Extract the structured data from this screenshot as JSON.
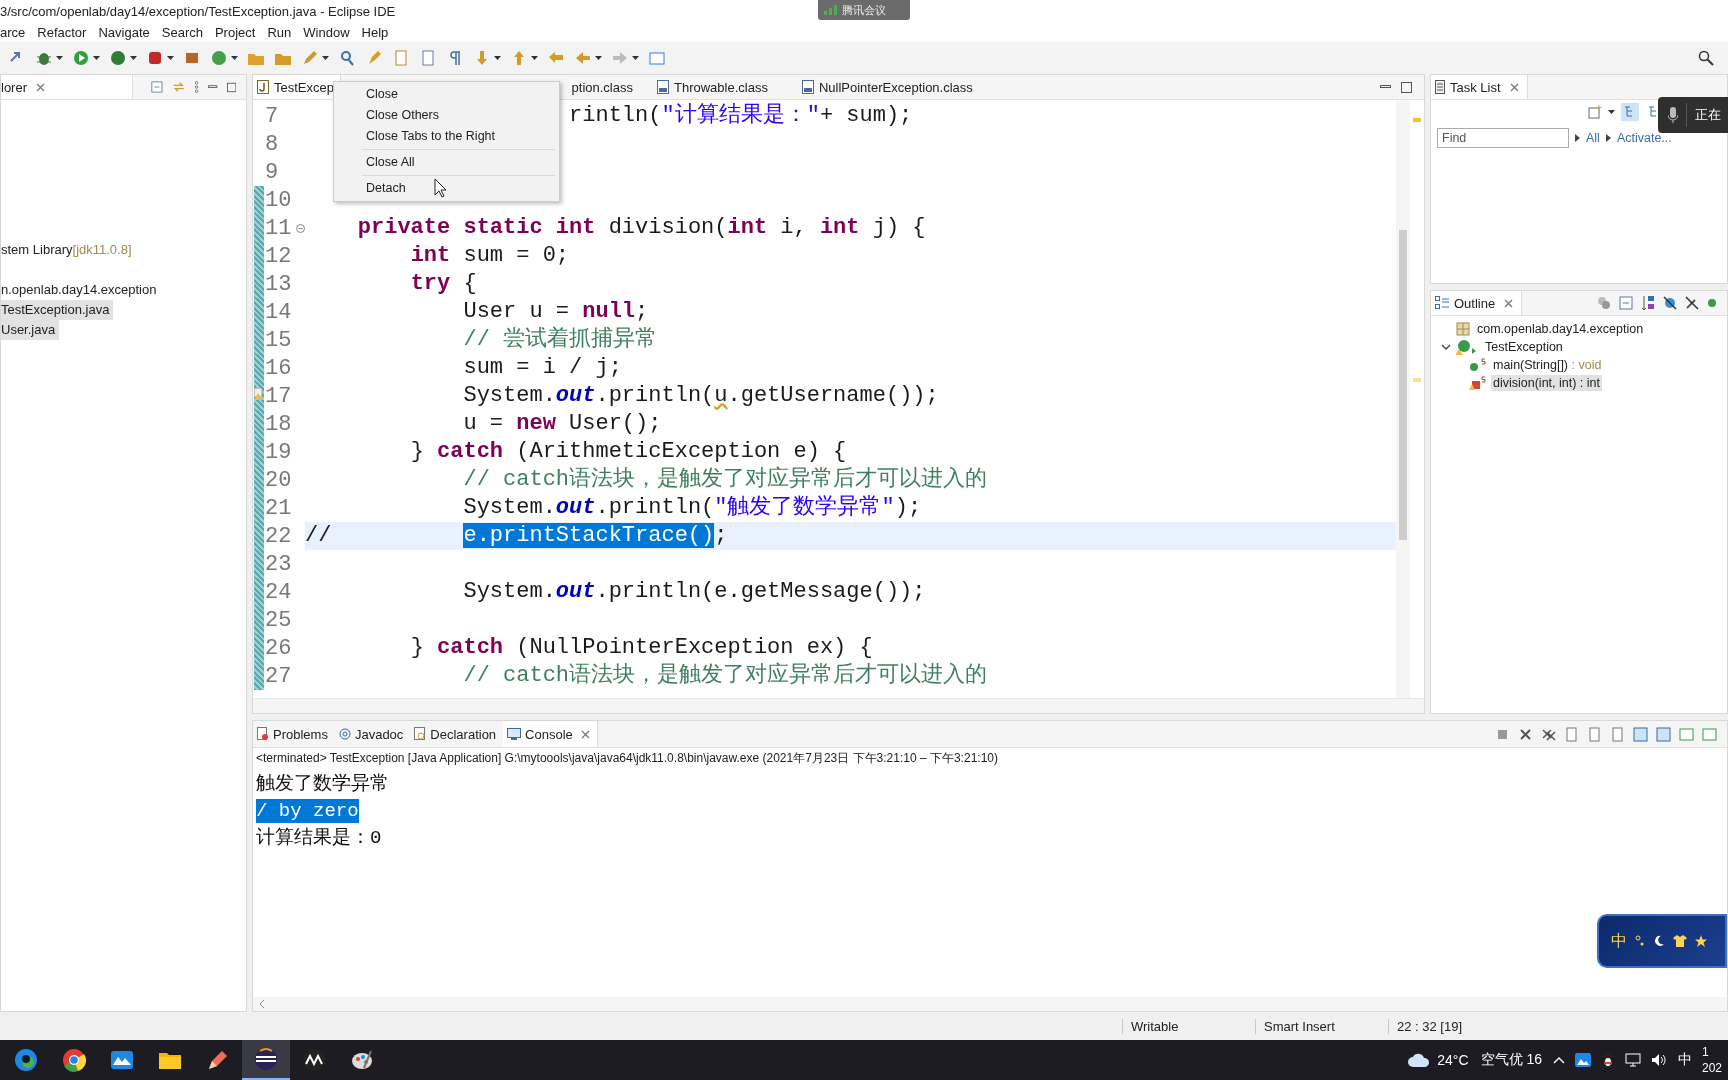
{
  "window": {
    "title": "3/src/com/openlab/day14/exception/TestException.java - Eclipse IDE"
  },
  "meeting_badge": {
    "label": "腾讯会议"
  },
  "menu": [
    "arce",
    "Refactor",
    "Navigate",
    "Search",
    "Project",
    "Run",
    "Window",
    "Help"
  ],
  "explorer": {
    "tab": "lorer",
    "items": [
      {
        "label": "stem Library",
        "detail": "[jdk11.0.8]",
        "selected": false
      },
      {
        "label": "n.openlab.day14.exception",
        "selected": false,
        "children": [
          {
            "label": "TestException.java",
            "selected": true
          },
          {
            "label": "User.java",
            "selected": true
          }
        ]
      }
    ]
  },
  "editor": {
    "tabs": [
      {
        "label": "TestExcep",
        "kind": "java",
        "selected": true
      },
      {
        "label": "ption.class",
        "selected": false
      },
      {
        "label": "Throwable.class",
        "kind": "class",
        "selected": false
      },
      {
        "label": "NullPointerException.class",
        "kind": "class",
        "selected": false
      }
    ],
    "lines": [
      {
        "number": "7",
        "changed": false,
        "current": false,
        "tokens": [
          {
            "text": "                    rintln(",
            "kind": "p"
          },
          {
            "text": "\"计算结果是：\"",
            "kind": "s"
          },
          {
            "text": "+ sum);",
            "kind": "p"
          }
        ]
      },
      {
        "number": "8",
        "changed": false,
        "current": false
      },
      {
        "number": "9",
        "changed": false,
        "current": false
      },
      {
        "number": "10",
        "changed": true,
        "current": false
      },
      {
        "number": "11",
        "changed": true,
        "current": false,
        "kind": "fold",
        "tokens": [
          {
            "text": "    private ",
            "kind": "k"
          },
          {
            "text": "static ",
            "kind": "k"
          },
          {
            "text": "int",
            "kind": "k"
          },
          {
            "text": " division(",
            "kind": "p"
          },
          {
            "text": "int",
            "kind": "k"
          },
          {
            "text": " i, ",
            "kind": "p"
          },
          {
            "text": "int",
            "kind": "k"
          },
          {
            "text": " j) {",
            "kind": "p"
          }
        ]
      },
      {
        "number": "12",
        "changed": true,
        "current": false,
        "tokens": [
          {
            "text": "        int",
            "kind": "k"
          },
          {
            "text": " sum = 0;",
            "kind": "p"
          }
        ]
      },
      {
        "number": "13",
        "changed": true,
        "current": false,
        "tokens": [
          {
            "text": "        try",
            "kind": "k"
          },
          {
            "text": " {",
            "kind": "p"
          }
        ]
      },
      {
        "number": "14",
        "changed": true,
        "current": false,
        "tokens": [
          {
            "text": "            User u = ",
            "kind": "p"
          },
          {
            "text": "null",
            "kind": "k"
          },
          {
            "text": ";",
            "kind": "p"
          }
        ]
      },
      {
        "number": "15",
        "changed": true,
        "current": false,
        "tokens": [
          {
            "text": "            // 尝试着抓捕异常",
            "kind": "c"
          }
        ]
      },
      {
        "number": "16",
        "changed": true,
        "current": false,
        "tokens": [
          {
            "text": "            sum = i / j;",
            "kind": "p"
          }
        ]
      },
      {
        "number": "17",
        "changed": true,
        "current": false,
        "kind": "warning",
        "tokens": [
          {
            "text": "            System.",
            "kind": "p"
          },
          {
            "text": "out",
            "kind": "f"
          },
          {
            "text": ".println(",
            "kind": "p"
          },
          {
            "text": "u",
            "kind": "w"
          },
          {
            "text": ".getUsername());",
            "kind": "p"
          }
        ]
      },
      {
        "number": "18",
        "changed": true,
        "current": false,
        "tokens": [
          {
            "text": "            u = ",
            "kind": "p"
          },
          {
            "text": "new",
            "kind": "k"
          },
          {
            "text": " User();",
            "kind": "p"
          }
        ]
      },
      {
        "number": "19",
        "changed": true,
        "current": false,
        "tokens": [
          {
            "text": "        } ",
            "kind": "p"
          },
          {
            "text": "catch",
            "kind": "k"
          },
          {
            "text": " (ArithmeticException e) {",
            "kind": "p"
          }
        ]
      },
      {
        "number": "20",
        "changed": true,
        "current": false,
        "tokens": [
          {
            "text": "            // catch语法块，是触发了对应异常后才可以进入的",
            "kind": "c"
          }
        ]
      },
      {
        "number": "21",
        "changed": true,
        "current": false,
        "tokens": [
          {
            "text": "            System.",
            "kind": "p"
          },
          {
            "text": "out",
            "kind": "f"
          },
          {
            "text": ".println(",
            "kind": "p"
          },
          {
            "text": "\"触发了数学异常\"",
            "kind": "s"
          },
          {
            "text": ");",
            "kind": "p"
          }
        ]
      },
      {
        "number": "22",
        "changed": true,
        "current": true,
        "tokens": [
          {
            "text": "//          ",
            "kind": "p"
          },
          {
            "text": "e.printStackTrace()",
            "kind": "sel"
          },
          {
            "text": ";",
            "kind": "p"
          }
        ]
      },
      {
        "number": "23",
        "changed": true,
        "current": false
      },
      {
        "number": "24",
        "changed": true,
        "current": false,
        "tokens": [
          {
            "text": "            System.",
            "kind": "p"
          },
          {
            "text": "out",
            "kind": "f"
          },
          {
            "text": ".println(e.getMessage());",
            "kind": "p"
          }
        ]
      },
      {
        "number": "25",
        "changed": true,
        "current": false
      },
      {
        "number": "26",
        "changed": true,
        "current": false,
        "tokens": [
          {
            "text": "        } ",
            "kind": "p"
          },
          {
            "text": "catch",
            "kind": "k"
          },
          {
            "text": " (NullPointerException ex) {",
            "kind": "p"
          }
        ]
      },
      {
        "number": "27",
        "changed": true,
        "current": false,
        "tokens": [
          {
            "text": "            // catch语法块，是触发了对应异常后才可以进入的",
            "kind": "c"
          }
        ]
      }
    ]
  },
  "context_menu": {
    "groups": [
      [
        "Close",
        "Close Others",
        "Close Tabs to the Right"
      ],
      [
        "Close All"
      ],
      [
        "Detach"
      ]
    ]
  },
  "task_list": {
    "tab": "Task List",
    "find": {
      "placeholder": "Find"
    },
    "links": [
      "All",
      "Activate..."
    ]
  },
  "meeting_overlay": {
    "label": "正在"
  },
  "outline": {
    "tab": "Outline",
    "items": [
      {
        "label": "com.openlab.day14.exception",
        "kind": "package",
        "selected": false
      },
      {
        "label": "TestException",
        "kind": "class",
        "expanded": true,
        "selected": false,
        "children": [
          {
            "label": "main(String[])",
            "type": " : void",
            "kind": "public",
            "selected": false
          },
          {
            "label": "division(int, int) : int",
            "kind": "private",
            "selected": true
          }
        ]
      }
    ]
  },
  "console": {
    "tabs": [
      {
        "label": "Problems",
        "kind": "problems",
        "selected": false
      },
      {
        "label": "Javadoc",
        "kind": "at",
        "selected": false
      },
      {
        "label": "Declaration",
        "kind": "declaration",
        "selected": false
      },
      {
        "label": "Console",
        "kind": "console",
        "selected": true
      }
    ],
    "status": "<terminated> TestException [Java Application] G:\\mytoools\\java\\java64\\jdk11.0.8\\bin\\javaw.exe  (2021年7月23日 下午3:21:10 – 下午3:21:10)",
    "output": [
      {
        "text": "触发了数学异常",
        "selected": false
      },
      {
        "text": "/ by zero",
        "selected": true
      },
      {
        "text": "计算结果是：0",
        "selected": false
      }
    ]
  },
  "ime_widget": {
    "label": "中"
  },
  "status_bar": [
    "Writable",
    "Smart Insert",
    "22 : 32 [19]"
  ],
  "taskbar": {
    "apps": [
      {
        "kind": "edge",
        "active": false
      },
      {
        "kind": "chrome",
        "active": false
      },
      {
        "kind": "board",
        "active": false
      },
      {
        "kind": "folder",
        "active": false
      },
      {
        "kind": "tool",
        "active": false
      },
      {
        "kind": "eclipse",
        "active": true
      },
      {
        "kind": "app",
        "active": false
      },
      {
        "kind": "paint",
        "active": false
      }
    ],
    "weather": "24°C",
    "air": "空气优 16",
    "ime": "中",
    "clock": [
      "1",
      "202"
    ]
  }
}
